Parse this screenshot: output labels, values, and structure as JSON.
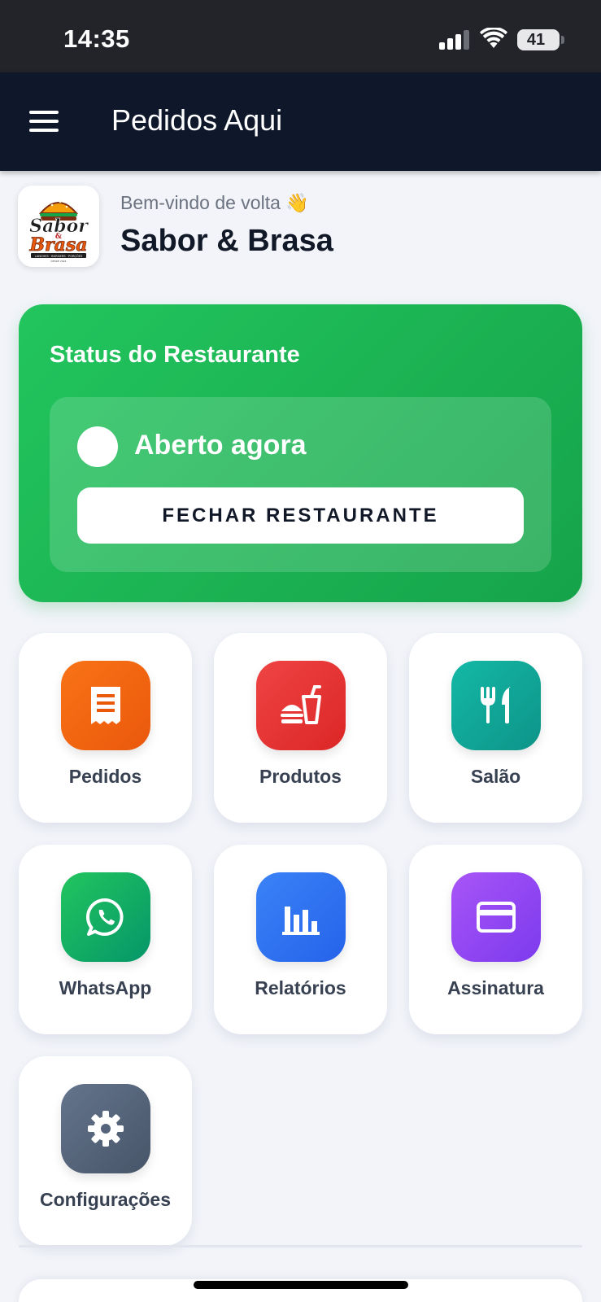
{
  "status_bar": {
    "time": "14:35",
    "battery": "41"
  },
  "app_bar": {
    "title": "Pedidos Aqui"
  },
  "header": {
    "welcome": "Bem-vindo de volta 👋",
    "restaurant_name": "Sabor & Brasa",
    "logo": {
      "line1": "Sabor",
      "line2": "&",
      "line3": "Brasa",
      "tagline": "LANCHES · BURGERS · PORÇÕES",
      "since": "DESDE 2024"
    }
  },
  "status_card": {
    "title": "Status do Restaurante",
    "state": "Aberto agora",
    "button_label": "FECHAR RESTAURANTE",
    "color": "#22c55e"
  },
  "tiles": [
    {
      "label": "Pedidos",
      "icon": "receipt-icon",
      "color": "#f97316"
    },
    {
      "label": "Produtos",
      "icon": "fast-food-icon",
      "color": "#ef4444"
    },
    {
      "label": "Salão",
      "icon": "utensils-icon",
      "color": "#14b8a6"
    },
    {
      "label": "WhatsApp",
      "icon": "whatsapp-icon",
      "color": "#22c55e"
    },
    {
      "label": "Relatórios",
      "icon": "bar-chart-icon",
      "color": "#3b82f6"
    },
    {
      "label": "Assinatura",
      "icon": "credit-card-icon",
      "color": "#a855f7"
    },
    {
      "label": "Configurações",
      "icon": "gear-icon",
      "color": "#64748b"
    }
  ]
}
